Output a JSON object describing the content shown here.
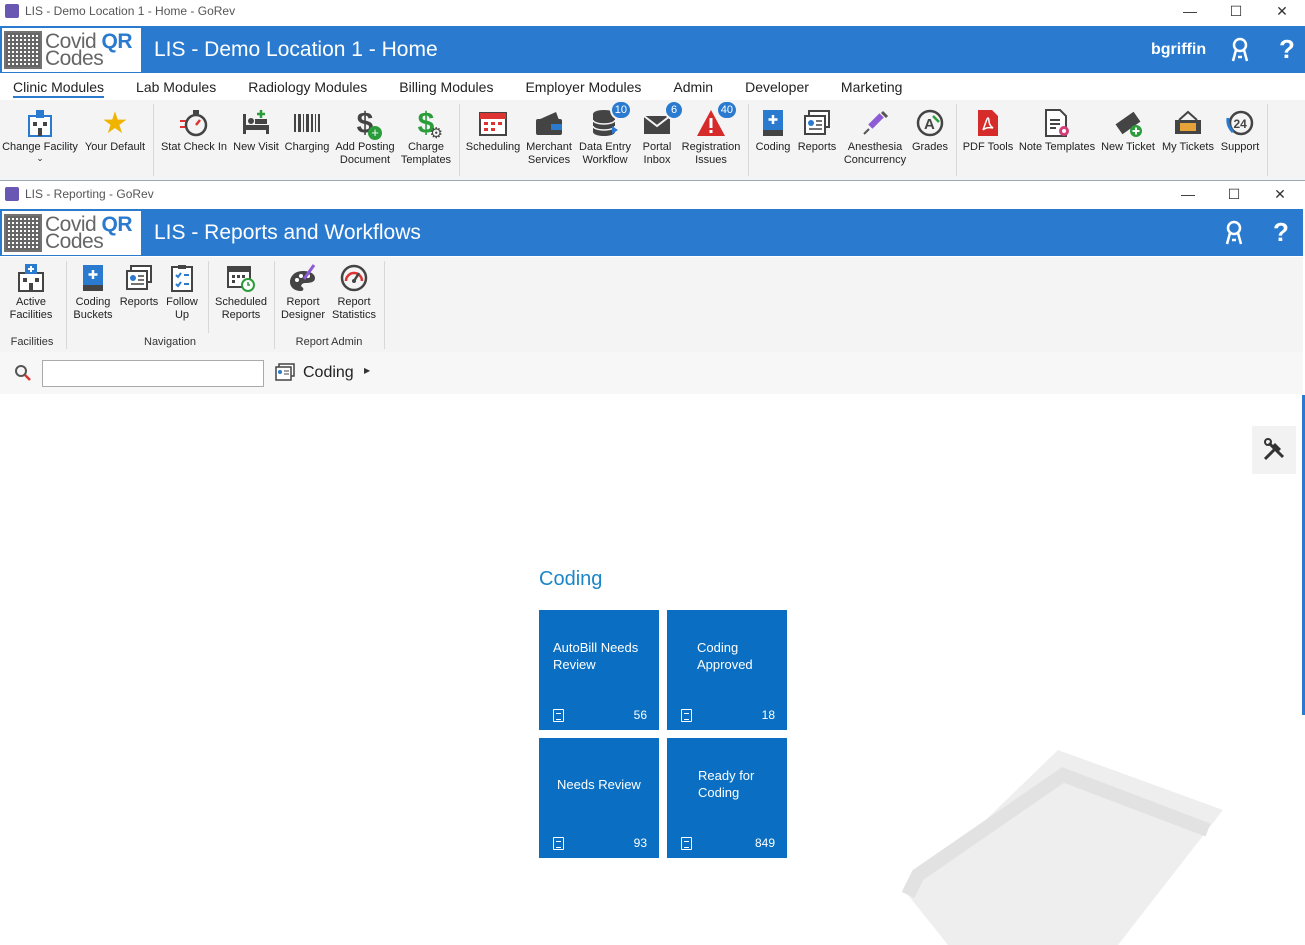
{
  "main_window": {
    "titlebar": "LIS - Demo Location 1 - Home - GoRev",
    "header_title": "LIS - Demo Location 1 - Home",
    "username": "bgriffin",
    "help_glyph": "?",
    "logo": {
      "line1": "Covid",
      "qr": "QR",
      "line2": "Codes"
    },
    "menu_tabs": [
      "Clinic Modules",
      "Lab Modules",
      "Radiology Modules",
      "Billing Modules",
      "Employer Modules",
      "Admin",
      "Developer",
      "Marketing"
    ],
    "ribbon": [
      {
        "line1": "Change Facility",
        "line2": "",
        "icon": "hospital-icon"
      },
      {
        "line1": "Your Default",
        "line2": "",
        "icon": "star-icon"
      },
      {
        "line1": "Stat Check In",
        "line2": "",
        "icon": "stopwatch-icon"
      },
      {
        "line1": "New Visit",
        "line2": "",
        "icon": "bed-icon"
      },
      {
        "line1": "Charging",
        "line2": "",
        "icon": "barcode-icon"
      },
      {
        "line1": "Add Posting",
        "line2": "Document",
        "icon": "dollar-add-icon"
      },
      {
        "line1": "Charge",
        "line2": "Templates",
        "icon": "dollar-gear-icon"
      },
      {
        "line1": "Scheduling",
        "line2": "",
        "icon": "calendar-icon"
      },
      {
        "line1": "Merchant",
        "line2": "Services",
        "icon": "wallet-icon"
      },
      {
        "line1": "Data Entry",
        "line2": "Workflow",
        "icon": "database-icon",
        "badge": "10"
      },
      {
        "line1": "Portal",
        "line2": "Inbox",
        "icon": "envelope-icon",
        "badge": "6"
      },
      {
        "line1": "Registration",
        "line2": "Issues",
        "icon": "warning-icon",
        "badge": "40"
      },
      {
        "line1": "Coding",
        "line2": "",
        "icon": "book-icon"
      },
      {
        "line1": "Reports",
        "line2": "",
        "icon": "reports-icon"
      },
      {
        "line1": "Anesthesia",
        "line2": "Concurrency",
        "icon": "syringe-icon"
      },
      {
        "line1": "Grades",
        "line2": "",
        "icon": "grades-icon"
      },
      {
        "line1": "PDF Tools",
        "line2": "",
        "icon": "pdf-icon"
      },
      {
        "line1": "Note Templates",
        "line2": "",
        "icon": "note-gear-icon"
      },
      {
        "line1": "New Ticket",
        "line2": "",
        "icon": "ticket-add-icon"
      },
      {
        "line1": "My Tickets",
        "line2": "",
        "icon": "tickets-icon"
      },
      {
        "line1": "Support",
        "line2": "",
        "icon": "support-24-icon"
      }
    ]
  },
  "reporting_window": {
    "titlebar": "LIS - Reporting - GoRev",
    "header_title": "LIS - Reports and Workflows",
    "help_glyph": "?",
    "ribbon": [
      {
        "line1": "Active",
        "line2": "Facilities",
        "icon": "hospital-icon"
      },
      {
        "line1": "Coding",
        "line2": "Buckets",
        "icon": "book-icon"
      },
      {
        "line1": "Reports",
        "line2": "",
        "icon": "reports-icon"
      },
      {
        "line1": "Follow",
        "line2": "Up",
        "icon": "checklist-icon"
      },
      {
        "line1": "Scheduled",
        "line2": "Reports",
        "icon": "calendar-clock-icon"
      },
      {
        "line1": "Report",
        "line2": "Designer",
        "icon": "palette-icon"
      },
      {
        "line1": "Report",
        "line2": "Statistics",
        "icon": "gauge-icon"
      }
    ],
    "groups": [
      "Facilities",
      "Navigation",
      "Report Admin"
    ],
    "search": {
      "value": "",
      "breadcrumb": "Coding"
    },
    "section_title": "Coding",
    "tiles": [
      {
        "label": "AutoBill Needs Review",
        "count": "56"
      },
      {
        "label": "Coding Approved",
        "count": "18"
      },
      {
        "label": "Needs Review",
        "count": "93"
      },
      {
        "label": "Ready for Coding",
        "count": "849"
      }
    ]
  }
}
